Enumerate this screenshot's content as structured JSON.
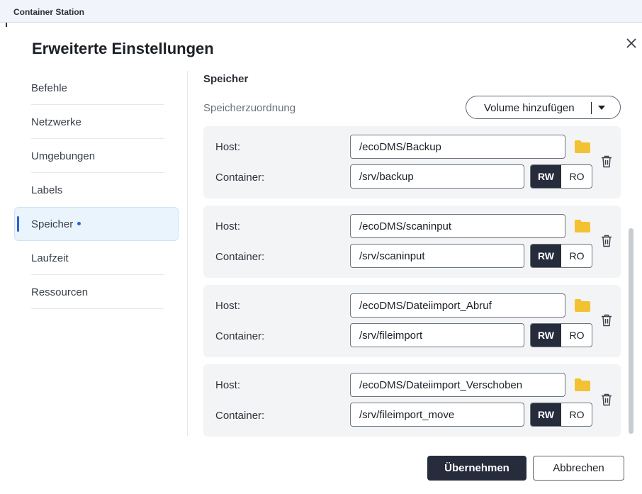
{
  "app": {
    "title": "Container Station"
  },
  "dialog": {
    "title": "Erweiterte Einstellungen",
    "close_icon": "close-icon"
  },
  "nav": {
    "items": [
      {
        "label": "Befehle",
        "active": false
      },
      {
        "label": "Netzwerke",
        "active": false
      },
      {
        "label": "Umgebungen",
        "active": false
      },
      {
        "label": "Labels",
        "active": false
      },
      {
        "label": "Speicher",
        "active": true
      },
      {
        "label": "Laufzeit",
        "active": false
      },
      {
        "label": "Ressourcen",
        "active": false
      }
    ]
  },
  "storage": {
    "section_title": "Speicher",
    "subsection_title": "Speicherzuordnung",
    "add_volume_label": "Volume hinzufügen",
    "host_label": "Host:",
    "container_label": "Container:",
    "rw_label": "RW",
    "ro_label": "RO",
    "mappings": [
      {
        "host": "/ecoDMS/Backup",
        "container": "/srv/backup",
        "mode": "RW"
      },
      {
        "host": "/ecoDMS/scaninput",
        "container": "/srv/scaninput",
        "mode": "RW"
      },
      {
        "host": "/ecoDMS/Dateiimport_Abruf",
        "container": "/srv/fileimport",
        "mode": "RW"
      },
      {
        "host": "/ecoDMS/Dateiimport_Verschoben",
        "container": "/srv/fileimport_move",
        "mode": "RW"
      }
    ]
  },
  "footer": {
    "apply_label": "Übernehmen",
    "cancel_label": "Abbrechen"
  },
  "colors": {
    "accent": "#2a63d4",
    "primary_button": "#262c3c",
    "folder": "#f3c232"
  }
}
